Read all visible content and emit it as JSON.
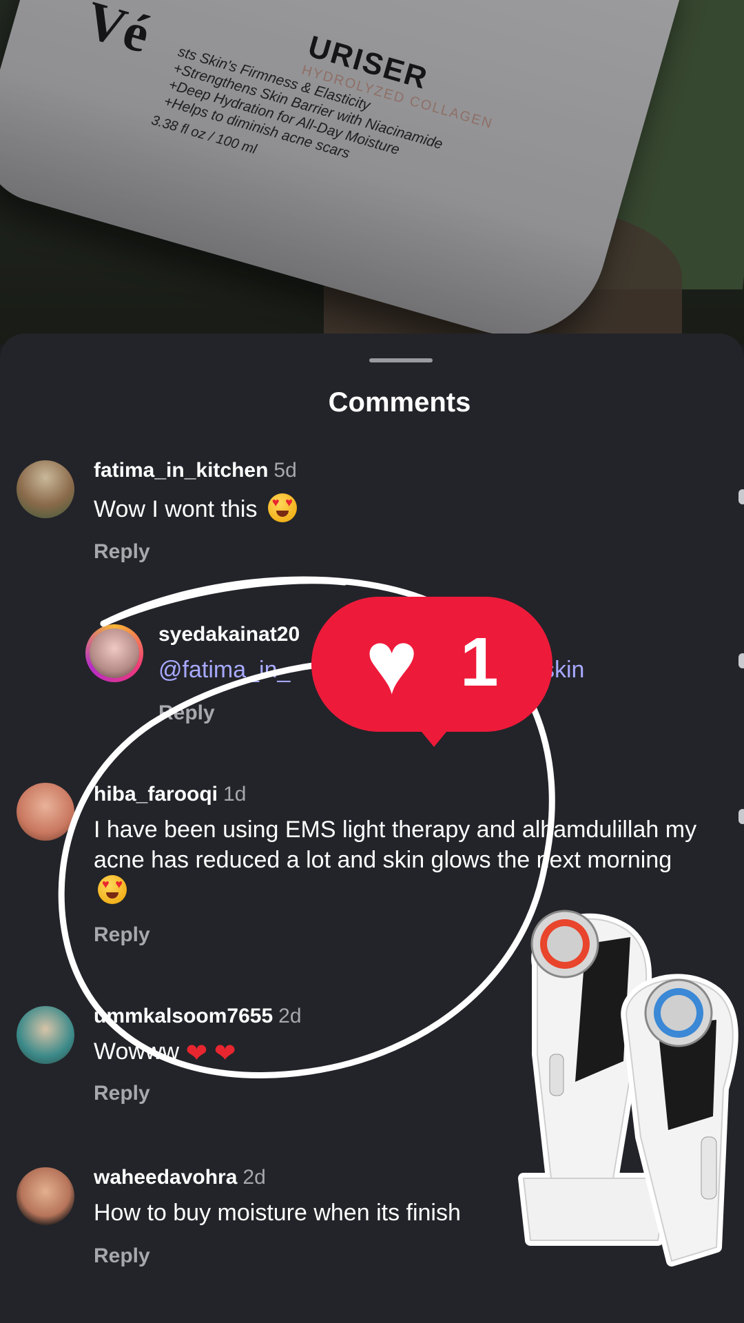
{
  "background_photo": {
    "brand_text": "Vé",
    "product_name": "URISER",
    "product_sub": "HYDROLYZED COLLAGEN",
    "claims": [
      "sts Skin's Firmness & Elasticity",
      "+Strengthens Skin Barrier with Niacinamide",
      "+Deep Hydration for All-Day Moisture",
      "+Helps to diminish acne scars"
    ],
    "volume": "3.38 fl oz / 100 ml"
  },
  "sheet": {
    "title": "Comments"
  },
  "comments": [
    {
      "username": "fatima_in_kitchen",
      "time": "5d",
      "text": "Wow I wont this",
      "emoji": "heart-eyes",
      "reply_label": "Reply"
    },
    {
      "username": "syedakainat20",
      "time": "",
      "mention": "@fatima_in_",
      "text_tail": "skin",
      "reply_label": "Reply"
    },
    {
      "username": "hiba_farooqi",
      "time": "1d",
      "text": "I have been using EMS light therapy and alhamdulillah my acne has reduced a lot and skin glows the next morning",
      "emoji": "heart-eyes",
      "reply_label": "Reply"
    },
    {
      "username": "ummkalsoom7655",
      "time": "2d",
      "text": "Wowww",
      "emoji": "red-hearts",
      "reply_label": "Reply"
    },
    {
      "username": "waheedavohra",
      "time": "2d",
      "text": "How to buy moisture when its finish",
      "reply_label": "Reply"
    }
  ],
  "like_badge": {
    "count": "1",
    "icon": "heart-icon",
    "color": "#ee1a3a"
  },
  "colors": {
    "sheet_bg": "#232429",
    "mention": "#a7a9ff",
    "muted_text": "#a7a8ad"
  }
}
